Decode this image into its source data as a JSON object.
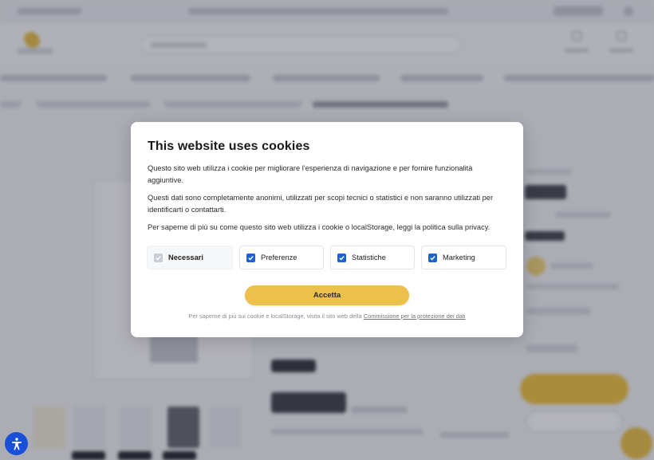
{
  "cookie_dialog": {
    "title": "This website uses cookies",
    "paragraph_1": "Questo sito web utilizza i cookie per migliorare l'esperienza di navigazione e per fornire funzionalità aggiuntive.",
    "paragraph_2": "Questi dati sono completamente anonimi, utilizzati per scopi tecnici o statistici e non saranno utilizzati per identificarti o contattarti.",
    "paragraph_3": "Per saperne di più su come questo sito web utilizza i cookie o localStorage, leggi la politica sulla privacy.",
    "options": [
      {
        "label": "Necessari",
        "checked": true,
        "disabled": true
      },
      {
        "label": "Preferenze",
        "checked": true,
        "disabled": false
      },
      {
        "label": "Statistiche",
        "checked": true,
        "disabled": false
      },
      {
        "label": "Marketing",
        "checked": true,
        "disabled": false
      }
    ],
    "accept_label": "Accetta",
    "footer_text": "Per saperne di più sui cookie e localStorage, visita il sito web della ",
    "footer_link": "Commissione per la protezione dei dati"
  },
  "accessibility_button": {
    "icon": "accessibility-icon",
    "color": "#1a4fd8"
  },
  "colors": {
    "accent": "#ecc14b",
    "checkbox": "#1e62d0"
  }
}
